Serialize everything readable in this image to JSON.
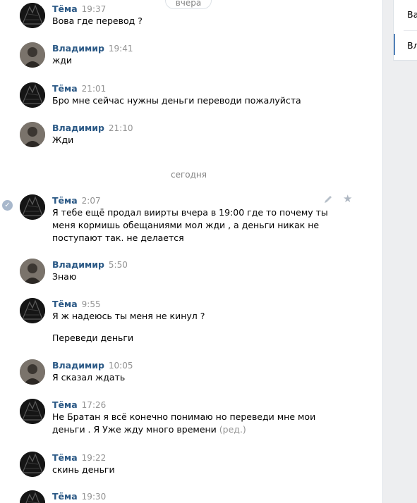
{
  "chat": {
    "date_top": "вчера",
    "date_today": "сегодня",
    "messages": [
      {
        "author": "Тёма",
        "time": "19:37",
        "text": "Вова где перевод ?"
      },
      {
        "author": "Владимир",
        "time": "19:41",
        "text": "жди"
      },
      {
        "author": "Тёма",
        "time": "21:01",
        "text": "Бро мне сейчас нужны деньги переводи пожалуйста"
      },
      {
        "author": "Владимир",
        "time": "21:10",
        "text": "Жди"
      },
      {
        "author": "Тёма",
        "time": "2:07",
        "text": "Я тебе ещё продал виирты вчера в 19:00 где то почему ты\nменя кормишь обещаниями мол жди , а деньги никак не\nпоступают так. не делается"
      },
      {
        "author": "Владимир",
        "time": "5:50",
        "text": "Знаю"
      },
      {
        "author": "Тёма",
        "time": "9:55",
        "text": "Я ж надеюсь ты меня не кинул ?",
        "text2": "Переведи деньги"
      },
      {
        "author": "Владимир",
        "time": "10:05",
        "text": "Я сказал ждать"
      },
      {
        "author": "Тёма",
        "time": "17:26",
        "text": "Не Братан я всё конечно понимаю но переведи мне мои\nденьги . Я Уже жду много времени",
        "edited": "(ред.)"
      },
      {
        "author": "Тёма",
        "time": "19:22",
        "text": "скинь деньги"
      },
      {
        "author": "Тёма",
        "time": "19:30",
        "text": ""
      }
    ]
  },
  "sidebar": {
    "item_top": "Ва",
    "item_active": "Вл"
  },
  "icons": {
    "read_check": "checkmark-icon",
    "edit": "pencil-icon",
    "favorite": "star-icon"
  },
  "colors": {
    "author": "#2a5885",
    "accent": "#5181b8",
    "muted": "#939393"
  }
}
